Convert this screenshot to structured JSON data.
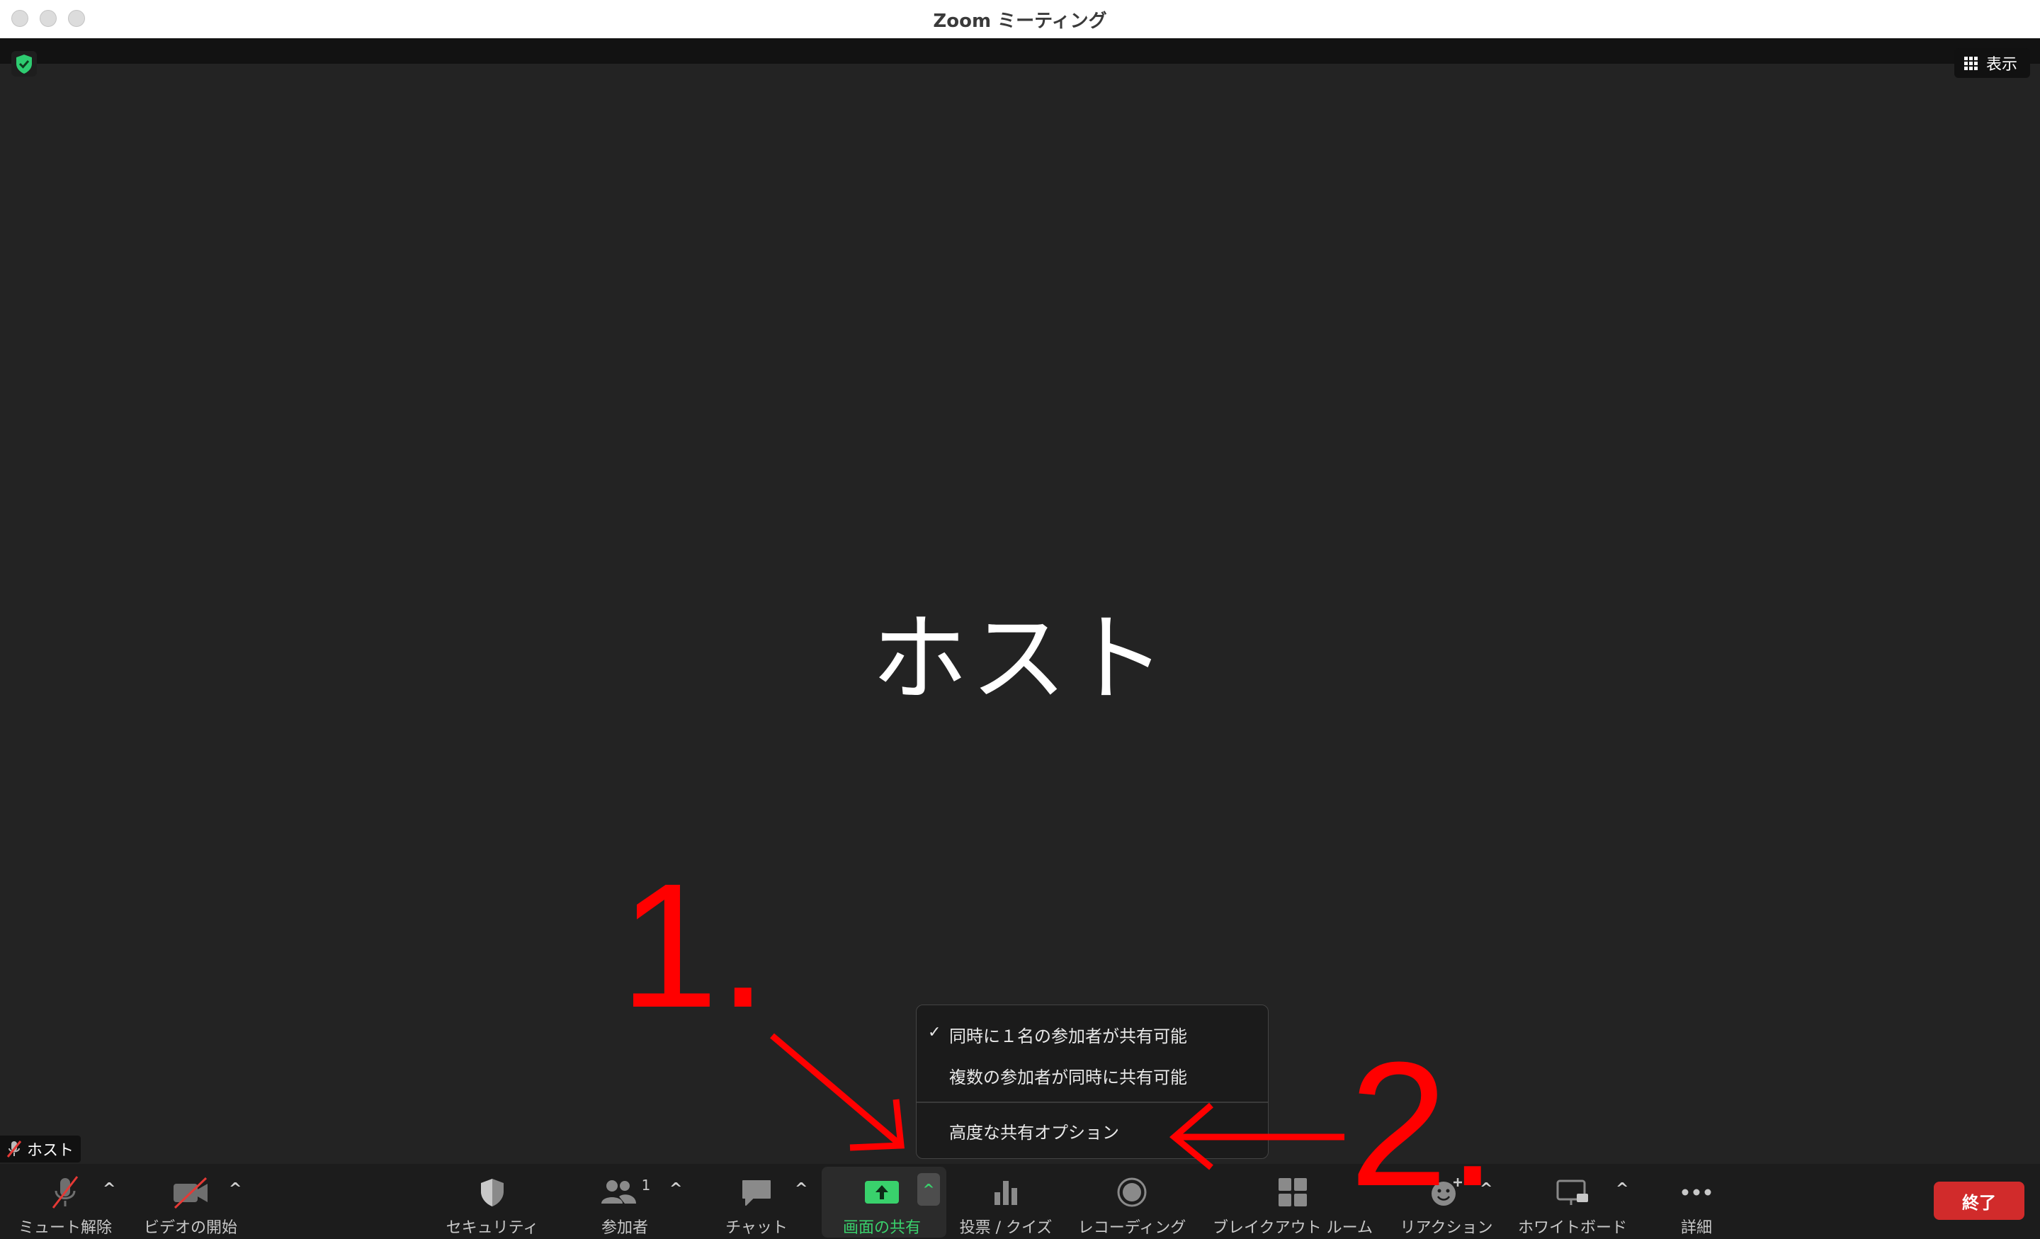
{
  "window": {
    "title": "Zoom ミーティング"
  },
  "view_button": {
    "label": "表示"
  },
  "main": {
    "participant_name": "ホスト",
    "name_tag": "ホスト"
  },
  "toolbar": {
    "unmute": "ミュート解除",
    "start_video": "ビデオの開始",
    "security": "セキュリティ",
    "participants": "参加者",
    "participants_count": "1",
    "chat": "チャット",
    "share_screen": "画面の共有",
    "polls": "投票 / クイズ",
    "recording": "レコーディング",
    "breakout": "ブレイクアウト ルーム",
    "reactions": "リアクション",
    "whiteboard": "ホワイトボード",
    "more": "詳細",
    "end": "終了"
  },
  "share_menu": {
    "items": [
      {
        "label": "同時に１名の参加者が共有可能",
        "checked": true
      },
      {
        "label": "複数の参加者が同時に共有可能",
        "checked": false
      },
      {
        "label": "高度な共有オプション",
        "checked": false
      }
    ]
  },
  "annotations": {
    "step1": "1.",
    "step2": "2."
  },
  "colors": {
    "accent_green": "#39d16c",
    "end_red": "#d12b2b",
    "annotation_red": "#ff0000"
  }
}
